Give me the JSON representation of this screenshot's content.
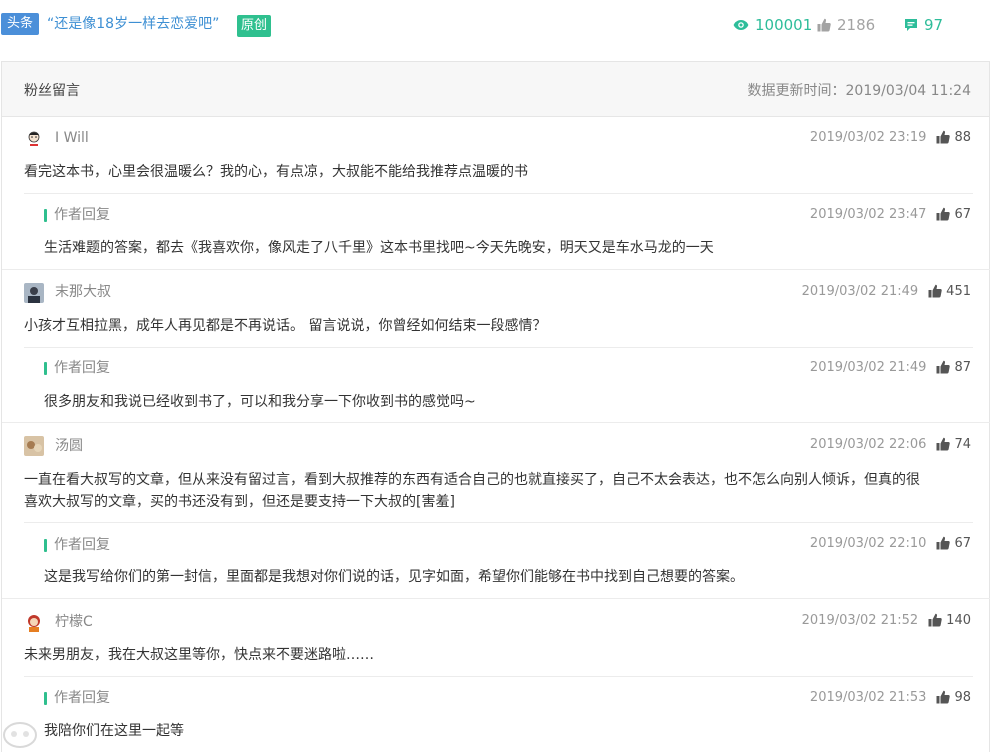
{
  "header": {
    "source_tag": "头条",
    "article_title": "“还是像18岁一样去恋爱吧”",
    "original_tag": "原创",
    "views": "100001",
    "likes": "2186",
    "comments": "97",
    "colors": {
      "accent_green": "#2ebd9a",
      "source_blue": "#4b8fd9",
      "title_blue": "#3d8fd3"
    }
  },
  "panel": {
    "title": "粉丝留言",
    "update_time": "数据更新时间：2019/03/04 11:24"
  },
  "comments": [
    {
      "user": "I Will",
      "avatar_icon": "cartoon-avatar-icon",
      "time": "2019/03/02 23:19",
      "likes": "88",
      "text": "看完这本书，心里会很温暖么？我的心，有点凉，大叔能不能给我推荐点温暖的书",
      "reply": {
        "label": "作者回复",
        "time": "2019/03/02 23:47",
        "likes": "67",
        "text": "生活难题的答案，都去《我喜欢你，像风走了八千里》这本书里找吧~今天先晚安，明天又是车水马龙的一天"
      }
    },
    {
      "user": "末那大叔",
      "avatar_icon": "photo-avatar-icon",
      "time": "2019/03/02 21:49",
      "likes": "451",
      "text": "小孩才互相拉黑，成年人再见都是不再说话。 留言说说，你曾经如何结束一段感情？",
      "reply": {
        "label": "作者回复",
        "time": "2019/03/02 21:49",
        "likes": "87",
        "text": "很多朋友和我说已经收到书了，可以和我分享一下你收到书的感觉吗~"
      }
    },
    {
      "user": "汤圆",
      "avatar_icon": "photo-avatar-icon",
      "time": "2019/03/02 22:06",
      "likes": "74",
      "text_line1": "一直在看大叔写的文章，但从来没有留过言，看到大叔推荐的东西有适合自己的也就直接买了，自己不太会表达，也不怎么向别人倾诉，但真的很",
      "text_line2": "喜欢大叔写的文章，买的书还没有到，但还是要支持一下大叔的[害羞]",
      "reply": {
        "label": "作者回复",
        "time": "2019/03/02 22:10",
        "likes": "67",
        "text": "这是我写给你们的第一封信，里面都是我想对你们说的话，见字如面，希望你们能够在书中找到自己想要的答案。"
      }
    },
    {
      "user": "柠檬C",
      "avatar_icon": "cartoon-avatar-icon",
      "time": "2019/03/02 21:52",
      "likes": "140",
      "text": "未来男朋友，我在大叔这里等你，快点来不要迷路啦……",
      "reply": {
        "label": "作者回复",
        "time": "2019/03/02 21:53",
        "likes": "98",
        "text": "我陪你们在这里一起等"
      }
    }
  ]
}
